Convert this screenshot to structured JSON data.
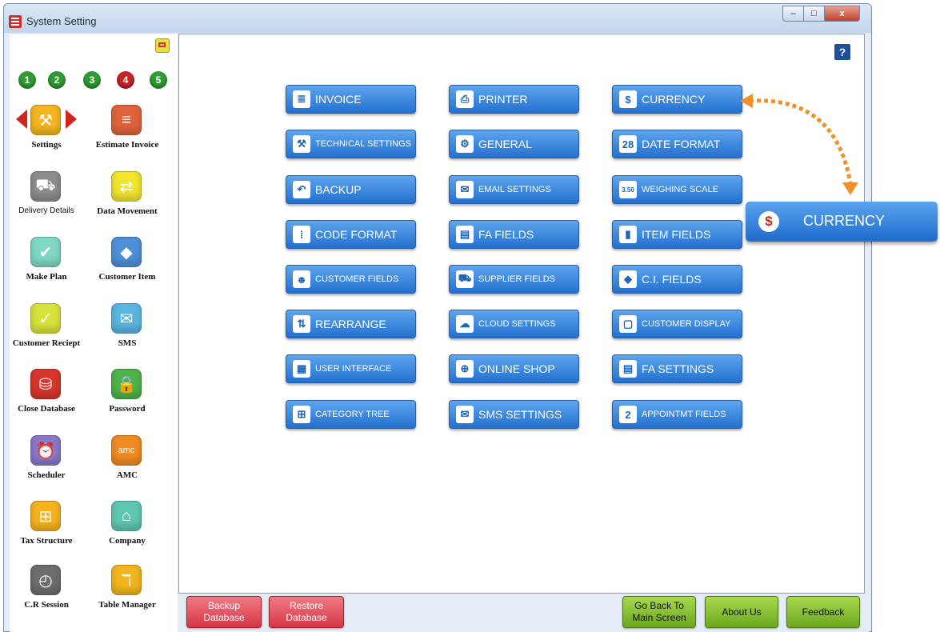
{
  "window": {
    "title": "System Setting",
    "controls": {
      "minimize": "–",
      "maximize": "□",
      "close": "x"
    }
  },
  "help_label": "?",
  "page_dots": [
    "1",
    "2",
    "3",
    "4",
    "5"
  ],
  "sidebar": {
    "items": [
      {
        "label": "Settings",
        "icon": "settings-icon",
        "color": "#f5b51f",
        "glyph": "⚒"
      },
      {
        "label": "Estimate Invoice",
        "icon": "estimate-invoice-icon",
        "color": "#e0633c",
        "glyph": "≡"
      },
      {
        "label": "Delivery Details",
        "icon": "delivery-icon",
        "color": "#8c8c8c",
        "glyph": "⛟"
      },
      {
        "label": "Data Movement",
        "icon": "data-movement-icon",
        "color": "#f1e530",
        "glyph": "⇄"
      },
      {
        "label": "Make Plan",
        "icon": "make-plan-icon",
        "color": "#7fd8c4",
        "glyph": "✔"
      },
      {
        "label": "Customer Item",
        "icon": "customer-item-icon",
        "color": "#4f8fd8",
        "glyph": "◆"
      },
      {
        "label": "Customer Reciept",
        "icon": "customer-receipt-icon",
        "color": "#d7e33a",
        "glyph": "✓"
      },
      {
        "label": "SMS",
        "icon": "sms-icon",
        "color": "#59b6e0",
        "glyph": "✉"
      },
      {
        "label": "Close Database",
        "icon": "close-database-icon",
        "color": "#d8352b",
        "glyph": "⛁"
      },
      {
        "label": "Password",
        "icon": "password-icon",
        "color": "#4fb24a",
        "glyph": "🔒"
      },
      {
        "label": "Scheduler",
        "icon": "scheduler-icon",
        "color": "#8a78c8",
        "glyph": "⏰"
      },
      {
        "label": "AMC",
        "icon": "amc-icon",
        "color": "#f08a22",
        "glyph": "amc"
      },
      {
        "label": "Tax Structure",
        "icon": "tax-structure-icon",
        "color": "#f5b21f",
        "glyph": "⊞"
      },
      {
        "label": "Company",
        "icon": "company-icon",
        "color": "#5ec7b0",
        "glyph": "⌂"
      },
      {
        "label": "C.R Session",
        "icon": "cr-session-icon",
        "color": "#6d6d6d",
        "glyph": "◴"
      },
      {
        "label": "Table Manager",
        "icon": "table-manager-icon",
        "color": "#f3b51e",
        "glyph": "ℸ"
      }
    ]
  },
  "settings_buttons": [
    {
      "label": "INVOICE",
      "icon": "invoice-icon",
      "glyph": "≣"
    },
    {
      "label": "PRINTER",
      "icon": "printer-icon",
      "glyph": "⎙"
    },
    {
      "label": "CURRENCY",
      "icon": "currency-icon",
      "glyph": "$"
    },
    {
      "label": "TECHNICAL SETTINGS",
      "icon": "technical-settings-icon",
      "glyph": "⚒"
    },
    {
      "label": "GENERAL",
      "icon": "gear-icon",
      "glyph": "⚙"
    },
    {
      "label": "DATE FORMAT",
      "icon": "calendar-icon",
      "glyph": "28"
    },
    {
      "label": "BACKUP",
      "icon": "backup-icon",
      "glyph": "↶"
    },
    {
      "label": "EMAIL SETTINGS",
      "icon": "email-icon",
      "glyph": "✉"
    },
    {
      "label": "WEIGHING SCALE",
      "icon": "weighing-scale-icon",
      "glyph": "3.50"
    },
    {
      "label": "CODE FORMAT",
      "icon": "code-format-icon",
      "glyph": "⁞"
    },
    {
      "label": "FA FIELDS",
      "icon": "fa-fields-icon",
      "glyph": "▤"
    },
    {
      "label": "ITEM FIELDS",
      "icon": "item-fields-icon",
      "glyph": "▮"
    },
    {
      "label": "CUSTOMER FIELDS",
      "icon": "customer-fields-icon",
      "glyph": "☻"
    },
    {
      "label": "SUPPLIER FIELDS",
      "icon": "supplier-truck-icon",
      "glyph": "⛟"
    },
    {
      "label": "C.I. FIELDS",
      "icon": "ci-fields-icon",
      "glyph": "◆"
    },
    {
      "label": "REARRANGE",
      "icon": "rearrange-icon",
      "glyph": "⇅"
    },
    {
      "label": "CLOUD SETTINGS",
      "icon": "cloud-icon",
      "glyph": "☁"
    },
    {
      "label": "CUSTOMER DISPLAY",
      "icon": "customer-display-icon",
      "glyph": "▢"
    },
    {
      "label": "USER INTERFACE",
      "icon": "user-interface-icon",
      "glyph": "▦"
    },
    {
      "label": "ONLINE SHOP",
      "icon": "globe-icon",
      "glyph": "⊕"
    },
    {
      "label": "FA SETTINGS",
      "icon": "fa-settings-icon",
      "glyph": "▤"
    },
    {
      "label": "CATEGORY TREE",
      "icon": "category-tree-icon",
      "glyph": "⊞"
    },
    {
      "label": "SMS SETTINGS",
      "icon": "sms-settings-icon",
      "glyph": "✉"
    },
    {
      "label": "APPOINTMT FIELDS",
      "icon": "appointment-calendar-icon",
      "glyph": "2"
    }
  ],
  "callout": {
    "label": "CURRENCY",
    "icon": "currency-icon",
    "glyph": "$"
  },
  "bottom_buttons": {
    "backup_line1": "Backup",
    "backup_line2": "Database",
    "restore_line1": "Restore",
    "restore_line2": "Database",
    "goback_line1": "Go Back To",
    "goback_line2": "Main Screen",
    "about": "About Us",
    "feedback": "Feedback"
  },
  "colors": {
    "button_blue": "#2f7fd8",
    "accent_red": "#d0251d",
    "accent_green": "#7ab72a"
  }
}
